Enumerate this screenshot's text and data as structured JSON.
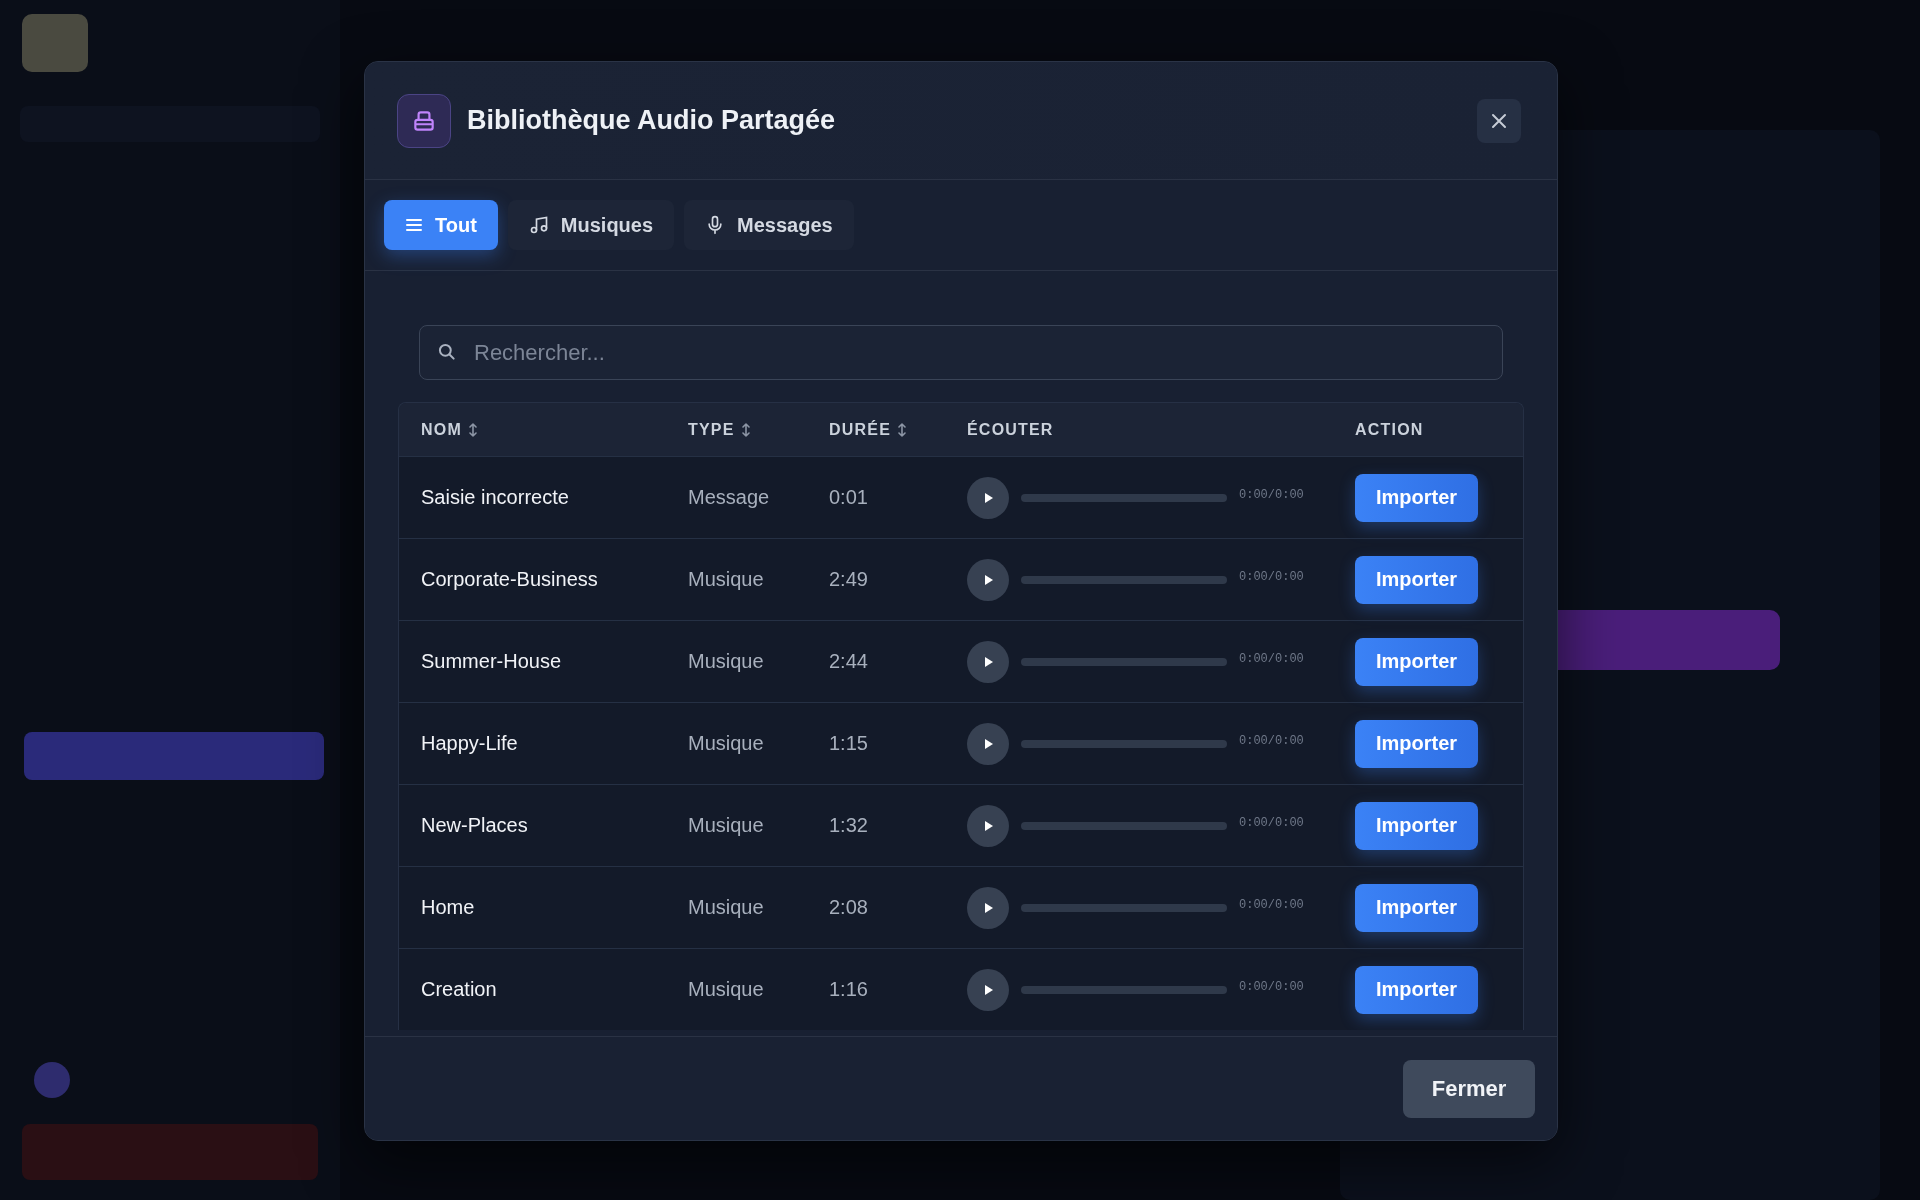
{
  "dialog": {
    "title": "Bibliothèque Audio Partagée",
    "close_label": "Fermer"
  },
  "tabs": [
    {
      "label": "Tout",
      "kind": "list",
      "selected": true
    },
    {
      "label": "Musiques",
      "kind": "music",
      "selected": false
    },
    {
      "label": "Messages",
      "kind": "mic",
      "selected": false
    }
  ],
  "search": {
    "placeholder": "Rechercher..."
  },
  "table": {
    "columns": [
      {
        "label": "NOM",
        "sortable": true
      },
      {
        "label": "TYPE",
        "sortable": true
      },
      {
        "label": "DURÉE",
        "sortable": true
      },
      {
        "label": "ÉCOUTER",
        "sortable": false
      },
      {
        "label": "ACTION",
        "sortable": false
      }
    ],
    "rows": [
      {
        "name": "Saisie incorrecte",
        "type": "Message",
        "duration": "0:01",
        "level": 0,
        "time": "0:00/0:00",
        "action": "Importer"
      },
      {
        "name": "Corporate-Business",
        "type": "Musique",
        "duration": "2:49",
        "level": 0,
        "time": "0:00/0:00",
        "action": "Importer"
      },
      {
        "name": "Summer-House",
        "type": "Musique",
        "duration": "2:44",
        "level": 0,
        "time": "0:00/0:00",
        "action": "Importer"
      },
      {
        "name": "Happy-Life",
        "type": "Musique",
        "duration": "1:15",
        "level": 0,
        "time": "0:00/0:00",
        "action": "Importer"
      },
      {
        "name": "New-Places",
        "type": "Musique",
        "duration": "1:32",
        "level": 0,
        "time": "0:00/0:00",
        "action": "Importer"
      },
      {
        "name": "Home",
        "type": "Musique",
        "duration": "2:08",
        "level": 0,
        "time": "0:00/0:00",
        "action": "Importer"
      },
      {
        "name": "Creation",
        "type": "Musique",
        "duration": "1:16",
        "level": 0,
        "time": "0:00/0:00",
        "action": "Importer"
      }
    ]
  }
}
